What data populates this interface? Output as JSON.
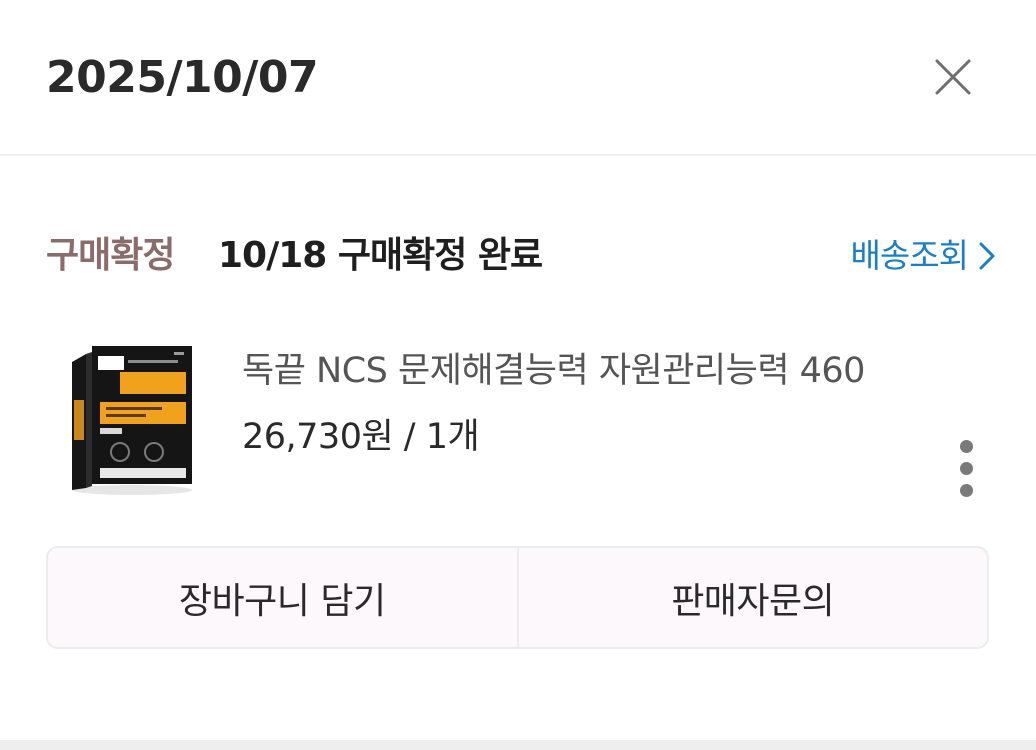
{
  "header": {
    "date": "2025/10/07",
    "close_icon": "close-icon"
  },
  "order": {
    "status_label": "구매확정",
    "status_text": "10/18 구매확정 완료",
    "tracking_label": "배송조회",
    "tracking_icon": "chevron-right-icon"
  },
  "product": {
    "name": "독끝 NCS 문제해결능력 자원관리능력 460",
    "price": "26,730원 / 1개",
    "more_icon": "more-vertical-icon"
  },
  "actions": {
    "cart_label": "장바구니 담기",
    "seller_inquiry_label": "판매자문의"
  },
  "colors": {
    "status_label": "#8a6d6b",
    "link": "#1a7fc8",
    "button_bg": "#fcf8fb",
    "book_accent": "#f0a21c"
  }
}
